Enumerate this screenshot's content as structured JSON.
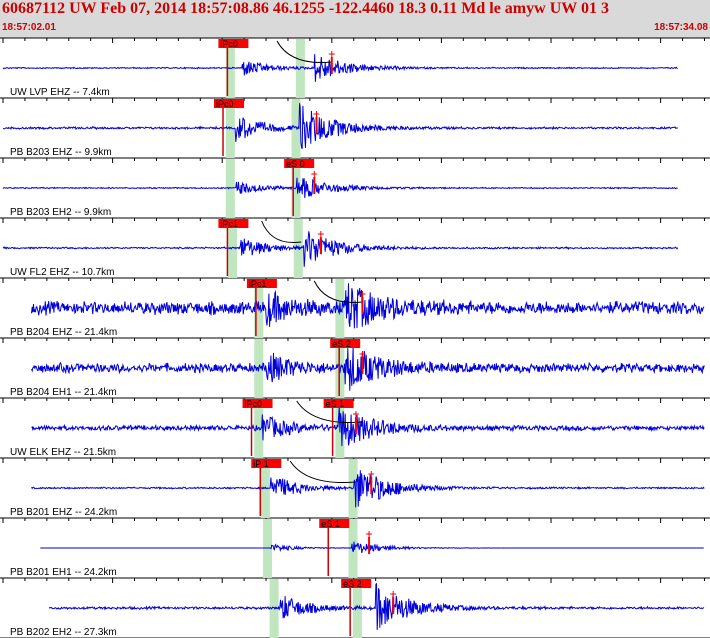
{
  "header": {
    "title": "60687112 UW Feb 07, 2014 18:57:08.86   46.1255 -122.4460 18.3 0.11 Md le amyw UW 01   3",
    "time_start": "18:57:02.01",
    "time_end": "18:57:34.08"
  },
  "colors": {
    "trace": "#0000dd",
    "pick_box": "#ff0000",
    "pick_line": "#cc0000",
    "window": "#bfe6bf",
    "header_bg": "#d9d9d9",
    "header_text": "#cc0000"
  },
  "chart_data": {
    "type": "line",
    "title": "60687112 UW Feb 07, 2014 18:57:08.86   46.1255 -122.4460 18.3 0.11 Md le amyw UW 01   3",
    "xlabel": "",
    "ylabel": "",
    "x_start": "18:57:02.01",
    "x_end": "18:57:34.08",
    "xlim": [
      0,
      32.07
    ],
    "series": [
      {
        "name": "UW LVP EHZ -- 7.4km",
        "start": 0.0,
        "end": 30.8,
        "noise": 0.03,
        "p_time": 10.9,
        "s_time": 14.2,
        "amp": 0.6,
        "picks": [
          {
            "label": "iPc0",
            "time": 10.1
          }
        ],
        "windows": [
          10.3,
          13.5
        ],
        "moveout": [
          12.5,
          15.0
        ]
      },
      {
        "name": "PB B203 EHZ -- 9.9km",
        "start": 0.0,
        "end": 30.8,
        "noise": 0.05,
        "p_time": 10.6,
        "s_time": 13.5,
        "amp": 1.0,
        "picks": [
          {
            "label": "iPc0",
            "time": 9.9
          }
        ],
        "windows": [
          10.3,
          13.3
        ],
        "moveout": []
      },
      {
        "name": "PB B203 EH2 -- 9.9km",
        "start": 0.0,
        "end": 30.8,
        "noise": 0.03,
        "p_time": 10.6,
        "s_time": 13.4,
        "amp": 0.5,
        "picks": [
          {
            "label": "eS 0",
            "time": 13.1
          }
        ],
        "windows": [
          10.3,
          13.3
        ],
        "moveout": []
      },
      {
        "name": "UW FL2 EHZ -- 10.7km",
        "start": 0.0,
        "end": 30.8,
        "noise": 0.04,
        "p_time": 10.8,
        "s_time": 13.7,
        "amp": 0.8,
        "picks": [
          {
            "label": "iPc1",
            "time": 10.1
          }
        ],
        "windows": [
          10.4,
          13.4
        ],
        "moveout": [
          11.8,
          13.6
        ]
      },
      {
        "name": "PB B204 EHZ -- 21.4km",
        "start": 1.3,
        "end": 32.0,
        "noise": 0.32,
        "p_time": 12.0,
        "s_time": 15.6,
        "amp": 1.0,
        "picks": [
          {
            "label": "iPc1",
            "time": 11.4
          }
        ],
        "windows": [
          11.6,
          15.3
        ],
        "moveout": [
          14.2,
          16.4
        ]
      },
      {
        "name": "PB B204 EH1 -- 21.4km",
        "start": 1.3,
        "end": 32.0,
        "noise": 0.22,
        "p_time": 12.0,
        "s_time": 15.6,
        "amp": 1.0,
        "picks": [
          {
            "label": "eS 2",
            "time": 15.2
          }
        ],
        "windows": [
          11.6,
          15.3
        ],
        "moveout": []
      },
      {
        "name": "UW ELK EHZ -- 21.5km",
        "start": 1.3,
        "end": 32.0,
        "noise": 0.12,
        "p_time": 11.8,
        "s_time": 15.3,
        "amp": 0.9,
        "picks": [
          {
            "label": "iPc0",
            "time": 11.2
          },
          {
            "label": "eS 1",
            "time": 14.9
          }
        ],
        "windows": [
          11.6,
          15.3
        ],
        "moveout": [
          13.4,
          16.4
        ]
      },
      {
        "name": "PB B201 EHZ -- 24.2km",
        "start": 1.3,
        "end": 32.0,
        "noise": 0.04,
        "p_time": 12.2,
        "s_time": 16.0,
        "amp": 1.0,
        "picks": [
          {
            "label": "iP 1",
            "time": 11.6
          }
        ],
        "windows": [
          11.9,
          15.9
        ],
        "moveout": [
          13.1,
          16.1
        ]
      },
      {
        "name": "PB B201 EH1 -- 24.2km",
        "start": 1.7,
        "end": 32.0,
        "noise": 0.0,
        "p_time": 12.2,
        "s_time": 15.9,
        "amp": 0.3,
        "picks": [
          {
            "label": "eS 1",
            "time": 14.7
          }
        ],
        "windows": [
          12.0,
          15.9
        ],
        "moveout": []
      },
      {
        "name": "PB B202 EH2 -- 27.3km",
        "start": 2.1,
        "end": 32.0,
        "noise": 0.06,
        "p_time": 12.6,
        "s_time": 17.0,
        "amp": 1.0,
        "picks": [
          {
            "label": "eS 2",
            "time": 15.7
          }
        ],
        "windows": [
          12.3,
          16.1
        ],
        "moveout": []
      }
    ]
  }
}
